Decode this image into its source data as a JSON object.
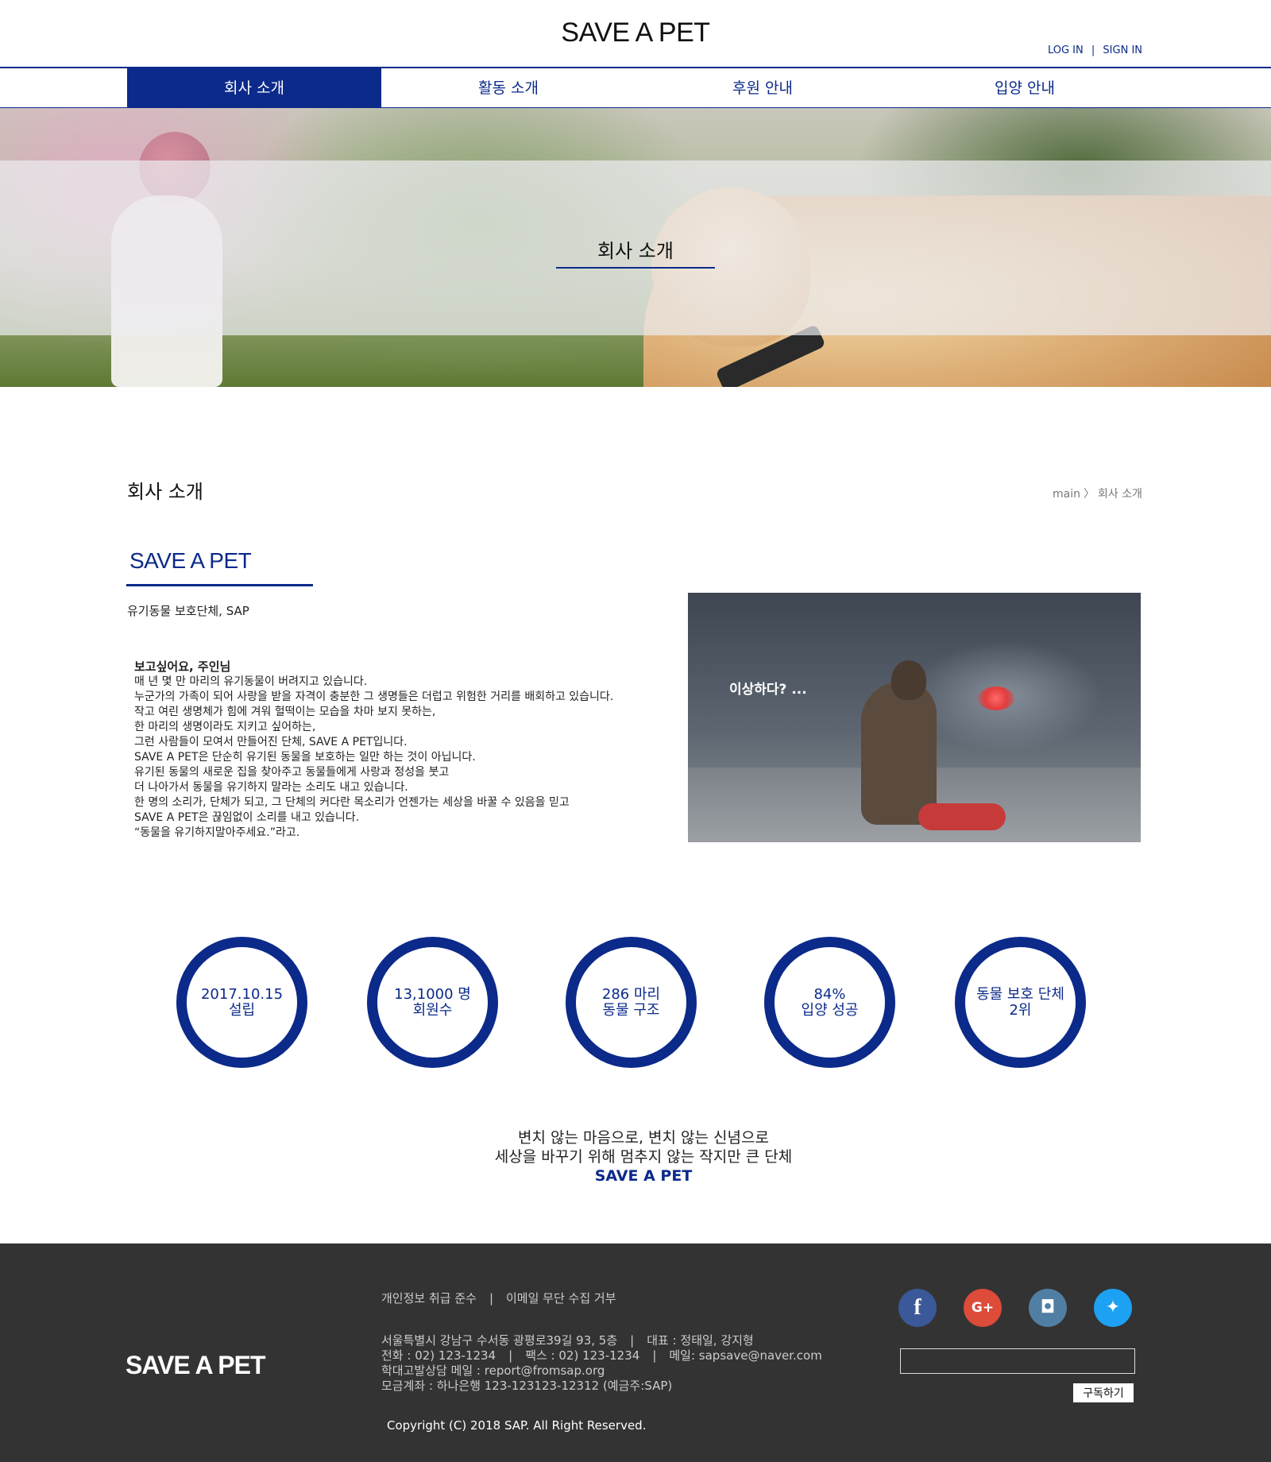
{
  "header": {
    "logo": "SAVE A PET",
    "login": "LOG IN",
    "separator": "|",
    "signin": "SIGN IN"
  },
  "nav": {
    "items": [
      {
        "label": "회사 소개",
        "active": true
      },
      {
        "label": "활동 소개",
        "active": false
      },
      {
        "label": "후원 안내",
        "active": false
      },
      {
        "label": "입양 안내",
        "active": false
      }
    ],
    "active_color": "#0b2a8a"
  },
  "hero": {
    "title": "회사 소개"
  },
  "page": {
    "title": "회사 소개",
    "breadcrumb": {
      "root": "main",
      "arrow": "〉",
      "current": "회사 소개"
    }
  },
  "about": {
    "brand": "SAVE A PET",
    "subtitle": "유기동물 보호단체, SAP",
    "story_title": "보고싶어요, 주인님",
    "story_lines": [
      "매 년 몇 만 마리의 유기동물이 버려지고 있습니다.",
      "누군가의 가족이 되어 사랑을 받을 자격이 충분한 그 생명들은 더럽고 위험한 거리를 배회하고 있습니다.",
      "작고 여린 생명체가 힘에 겨워 헐떡이는 모습을 차마 보지 못하는,",
      "한 마리의 생명이라도 지키고 싶어하는,",
      "그런 사람들이 모여서 만들어진 단체, SAVE A PET입니다.",
      "SAVE A PET은 단순히 유기된 동물을 보호하는 일만 하는 것이 아닙니다.",
      "유기된 동물의 새로운 집을 찾아주고 동물들에게 사랑과 정성을 붓고",
      "더 나아가서 동물을 유기하지 말라는 소리도 내고 있습니다.",
      "한 명의 소리가, 단체가 되고, 그 단체의 커다란 목소리가 언젠가는 세상을 바꿀 수 있음을 믿고",
      "SAVE A PET은 끊임없이 소리를 내고 있습니다.",
      "“동물을 유기하지말아주세요.”라고."
    ],
    "photo_caption": "이상하다? ..."
  },
  "stats": [
    {
      "line1": "2017.10.15",
      "line2": "설립"
    },
    {
      "line1": "13,1000 명",
      "line2": "회원수"
    },
    {
      "line1": "286 마리",
      "line2": "동물 구조"
    },
    {
      "line1": "84%",
      "line2": "입양 성공"
    },
    {
      "line1": "동물 보호 단체",
      "line2": "2위"
    }
  ],
  "slogan": {
    "line1": "변치 않는 마음으로, 변치 않는 신념으로",
    "line2": "세상을 바꾸기 위해 멈추지 않는 작지만 큰 단체",
    "line3": "SAVE A PET"
  },
  "footer": {
    "logo": "SAVE A PET",
    "link1": "개인정보 취급 준수",
    "link_sep": "|",
    "link2": "이메일 무단 수집 거부",
    "address": "서울특별시 강남구 수서동 광평로39길 93, 5층",
    "rep": "대표 : 정태일, 강지형",
    "phone": "전화 : 02) 123-1234",
    "fax": "팩스 : 02) 123-1234",
    "mail": "메일: sapsave@naver.com",
    "report": "학대고발상담 메일 : report@fromsap.org",
    "account": "모금계좌 : 하나은행 123-123123-12312 (예금주:SAP)",
    "info_sep": "|",
    "copyright": "Copyright (C) 2018 SAP. All Right Reserved.",
    "subscribe_value": "",
    "subscribe_button": "구독하기",
    "social": [
      {
        "icon": "facebook-icon",
        "glyph": "f",
        "color": "#3b5998"
      },
      {
        "icon": "google-plus-icon",
        "glyph": "G+",
        "color": "#dd4b39"
      },
      {
        "icon": "instagram-icon",
        "glyph": "◘",
        "color": "#517fa4"
      },
      {
        "icon": "twitter-icon",
        "glyph": "✦",
        "color": "#1da1f2"
      }
    ]
  }
}
